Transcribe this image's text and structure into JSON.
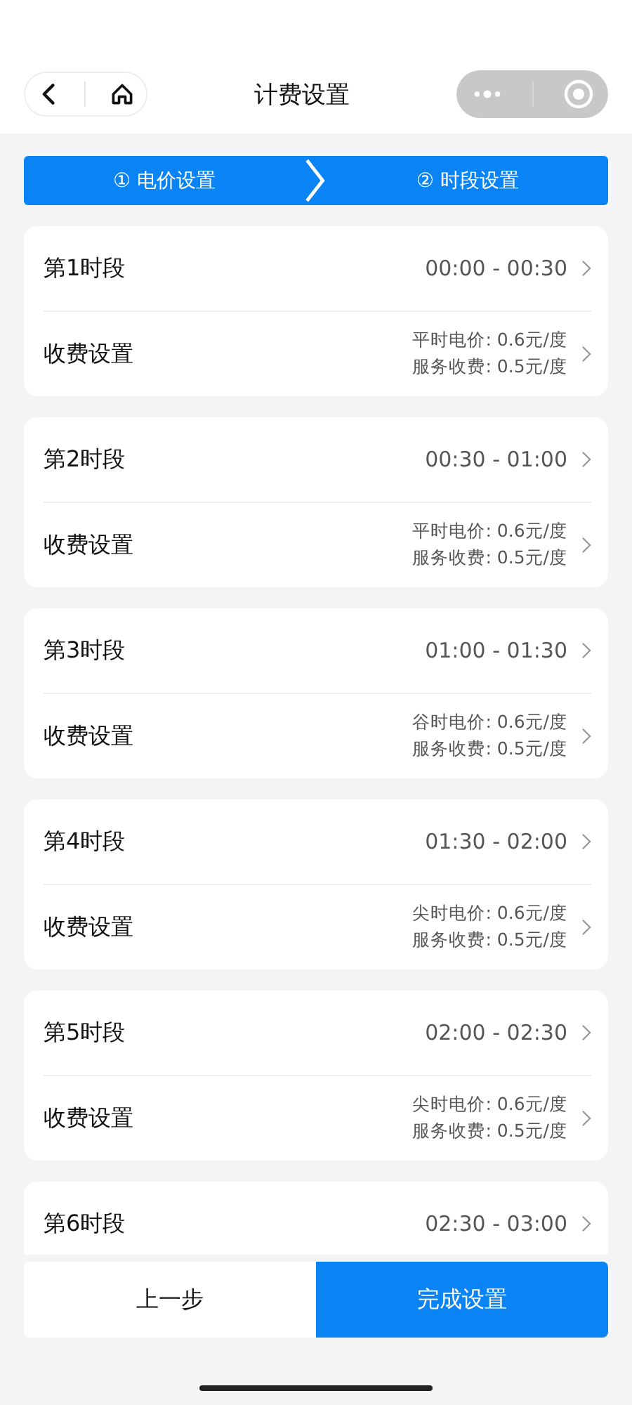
{
  "nav": {
    "title": "计费设置"
  },
  "steps": [
    {
      "label": "① 电价设置"
    },
    {
      "label": "② 时段设置"
    }
  ],
  "segments": [
    {
      "name": "第1时段",
      "time": "00:00 - 00:30",
      "fee_label": "收费设置",
      "price": "平时电价: 0.6元/度",
      "service": "服务收费: 0.5元/度"
    },
    {
      "name": "第2时段",
      "time": "00:30 - 01:00",
      "fee_label": "收费设置",
      "price": "平时电价: 0.6元/度",
      "service": "服务收费: 0.5元/度"
    },
    {
      "name": "第3时段",
      "time": "01:00 - 01:30",
      "fee_label": "收费设置",
      "price": "谷时电价: 0.6元/度",
      "service": "服务收费: 0.5元/度"
    },
    {
      "name": "第4时段",
      "time": "01:30 - 02:00",
      "fee_label": "收费设置",
      "price": "尖时电价: 0.6元/度",
      "service": "服务收费: 0.5元/度"
    },
    {
      "name": "第5时段",
      "time": "02:00 - 02:30",
      "fee_label": "收费设置",
      "price": "尖时电价: 0.6元/度",
      "service": "服务收费: 0.5元/度"
    },
    {
      "name": "第6时段",
      "time": "02:30 - 03:00"
    }
  ],
  "buttons": {
    "previous": "上一步",
    "finish": "完成设置"
  }
}
